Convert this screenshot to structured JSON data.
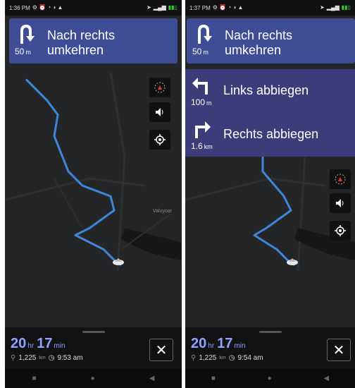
{
  "left": {
    "status": {
      "time": "1:36 PM"
    },
    "current": {
      "text_l1": "Nach rechts",
      "text_l2": "umkehren",
      "dist": "50",
      "unit": "m"
    },
    "map_label": "Valuyoar",
    "eta": {
      "hours": "20",
      "hours_unit": "hr",
      "mins": "17",
      "mins_unit": "min",
      "distance": "1,225",
      "distance_unit": "km",
      "arrival": "9:53 am"
    }
  },
  "right": {
    "status": {
      "time": "1:37 PM"
    },
    "current": {
      "text_l1": "Nach rechts",
      "text_l2": "umkehren",
      "dist": "50",
      "unit": "m"
    },
    "list": [
      {
        "text": "Links abbiegen",
        "dist": "100",
        "unit": "m",
        "icon": "turn-left-icon"
      },
      {
        "text": "Rechts abbiegen",
        "dist": "1.6",
        "unit": "km",
        "icon": "turn-right-icon"
      }
    ],
    "eta": {
      "hours": "20",
      "hours_unit": "hr",
      "mins": "17",
      "mins_unit": "min",
      "distance": "1,225",
      "distance_unit": "km",
      "arrival": "9:54 am"
    }
  },
  "close_label": "✕",
  "colors": {
    "card": "#3f4d96",
    "route": "#3d86d9",
    "eta_accent": "#8fa2ff"
  }
}
